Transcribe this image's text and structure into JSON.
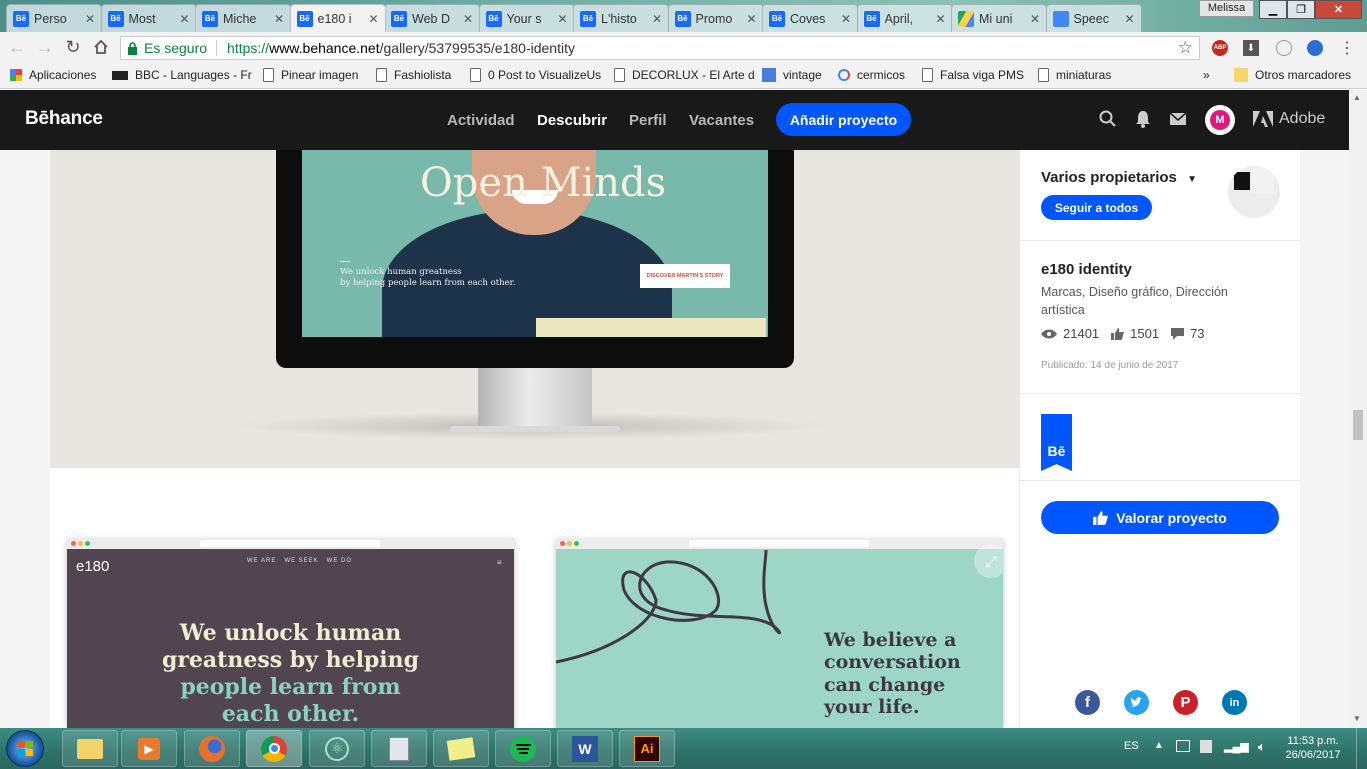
{
  "browser": {
    "tabs": [
      {
        "label": "Perso",
        "icon": "behance"
      },
      {
        "label": "Most",
        "icon": "behance"
      },
      {
        "label": "Miche",
        "icon": "behance"
      },
      {
        "label": "e180 i",
        "icon": "behance",
        "active": true
      },
      {
        "label": "Web D",
        "icon": "behance"
      },
      {
        "label": "Your s",
        "icon": "behance"
      },
      {
        "label": "L'histo",
        "icon": "behance"
      },
      {
        "label": "Promo",
        "icon": "behance"
      },
      {
        "label": "Coves",
        "icon": "behance"
      },
      {
        "label": "April,",
        "icon": "behance"
      },
      {
        "label": "Mi uni",
        "icon": "gdrive"
      },
      {
        "label": "Speec",
        "icon": "gdocs"
      }
    ],
    "window_user": "Melissa",
    "secure_label": "Es seguro",
    "url_scheme": "https://",
    "url_host": "www.behance.net",
    "url_path": "/gallery/53799535/e180-identity",
    "bookmarks": [
      {
        "label": "Aplicaciones",
        "icon": "apps-grid-icon"
      },
      {
        "label": "BBC - Languages - Fr",
        "icon": "bbc-icon"
      },
      {
        "label": "Pinear imagen",
        "icon": "page-icon"
      },
      {
        "label": "Fashiolista",
        "icon": "page-icon"
      },
      {
        "label": "0 Post to VisualizeUs",
        "icon": "page-icon"
      },
      {
        "label": "DECORLUX - El Arte d",
        "icon": "page-icon"
      },
      {
        "label": "vintage",
        "icon": "google-g-icon"
      },
      {
        "label": "cermicos",
        "icon": "google-icon"
      },
      {
        "label": "Falsa viga PMS",
        "icon": "page-icon"
      },
      {
        "label": "miniaturas",
        "icon": "page-icon"
      }
    ],
    "bookmarks_more": "»",
    "other_bookmarks": "Otros marcadores"
  },
  "behance": {
    "logo": "Bēhance",
    "nav": [
      "Actividad",
      "Descubrir",
      "Perfil",
      "Vacantes"
    ],
    "active_nav": "Descubrir",
    "add_project": "Añadir proyecto",
    "adobe": "Adobe",
    "accent": "#0057ff"
  },
  "project": {
    "hero": {
      "headline": "Open Minds",
      "subline_1": "We unlock human greatness",
      "subline_2": "by helping people learn from each other.",
      "cta": "DISCOVER MARTIN'S STORY"
    },
    "thumb_left": {
      "logo": "e180",
      "nav": "WE ARE   WE SEEK   WE DO",
      "line1": "We unlock human",
      "line2": "greatness by helping",
      "line3": "people learn from",
      "line4": "each other."
    },
    "thumb_right": {
      "line1": "We believe a",
      "line2": "conversation",
      "line3": "can change",
      "line4": "your life."
    }
  },
  "sidebar": {
    "owners_label": "Varios propietarios",
    "follow_all": "Seguir a todos",
    "title": "e180 identity",
    "fields": "Marcas, Diseño gráfico, Dirección artística",
    "views": "21401",
    "appreciations": "1501",
    "comments": "73",
    "published": "Publicado: 14 de junio de 2017",
    "badge": "Bē",
    "appreciate_button": "Valorar proyecto",
    "share": [
      "facebook",
      "twitter",
      "pinterest",
      "linkedin"
    ]
  },
  "taskbar": {
    "lang": "ES",
    "time": "11:53 p.m.",
    "date": "26/06/2017"
  }
}
